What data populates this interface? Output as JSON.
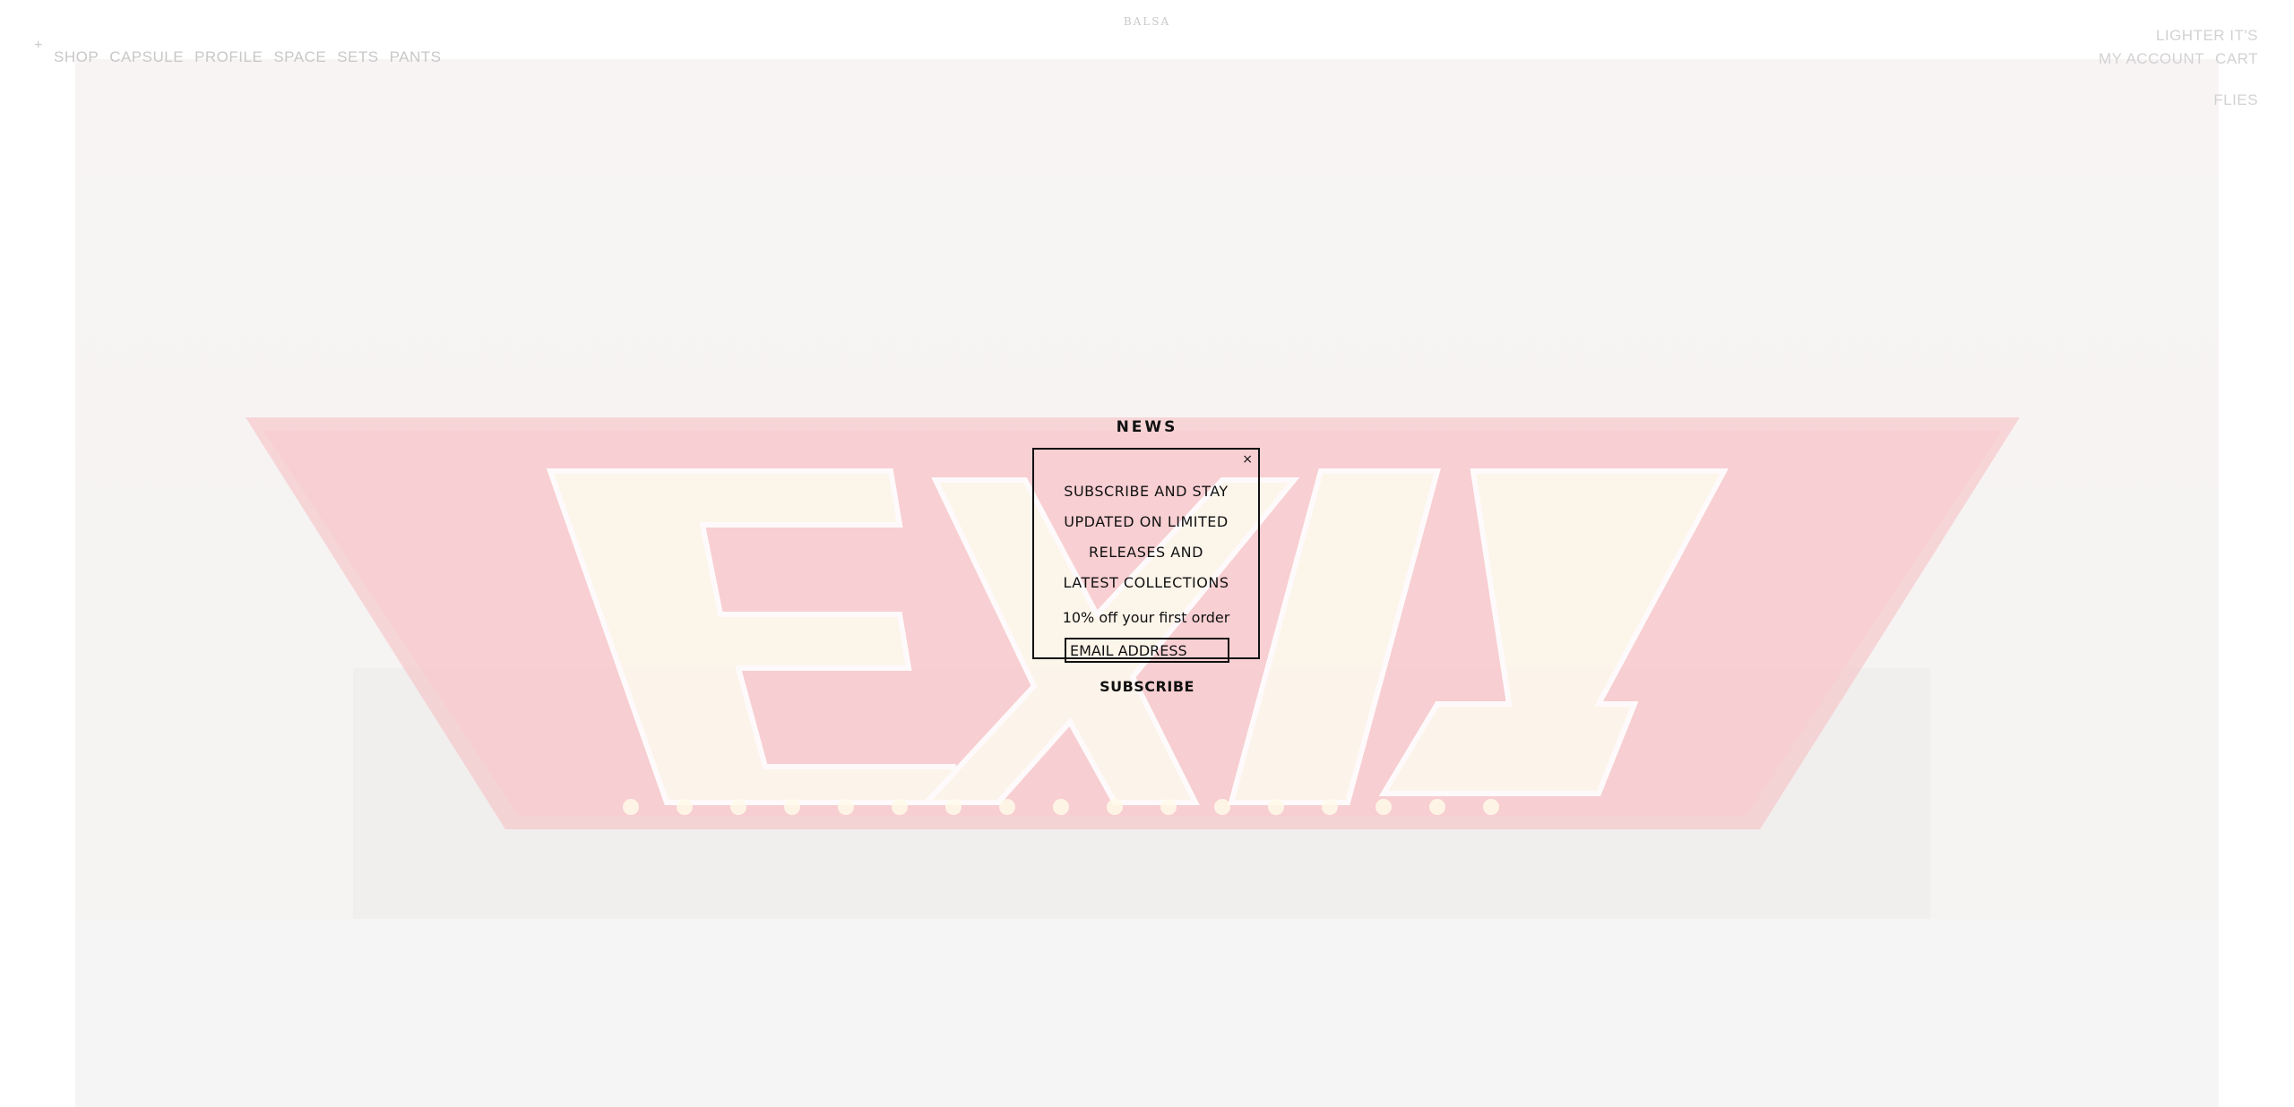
{
  "header": {
    "logo_text": "BALSA",
    "menu_icon": "plus-icon",
    "menu_glyph": "+",
    "nav": [
      {
        "label": "SHOP"
      },
      {
        "label": "CAPSULE"
      },
      {
        "label": "PROFILE"
      },
      {
        "label": "SPACE"
      },
      {
        "label": "SETS"
      },
      {
        "label": "PANTS"
      }
    ],
    "right": {
      "top_link": "LIGHTER IT'S",
      "account_link": "MY ACCOUNT",
      "cart_link": "CART",
      "lower_link": "FLIES"
    }
  },
  "hero": {
    "sign_text": "EXIT",
    "colors": {
      "sign_red": "#e8333a",
      "letters": "#fff3c4",
      "background": "#f4eeee"
    }
  },
  "modal": {
    "title": "NEWS",
    "close_glyph": "×",
    "message_lines": [
      "SUBSCRIBE AND STAY",
      "UPDATED ON LIMITED",
      "RELEASES AND",
      "LATEST COLLECTIONS"
    ],
    "offer": "10% off your first order",
    "email_placeholder": "EMAIL ADDRESS",
    "email_value": "",
    "subscribe_label": "SUBSCRIBE"
  }
}
